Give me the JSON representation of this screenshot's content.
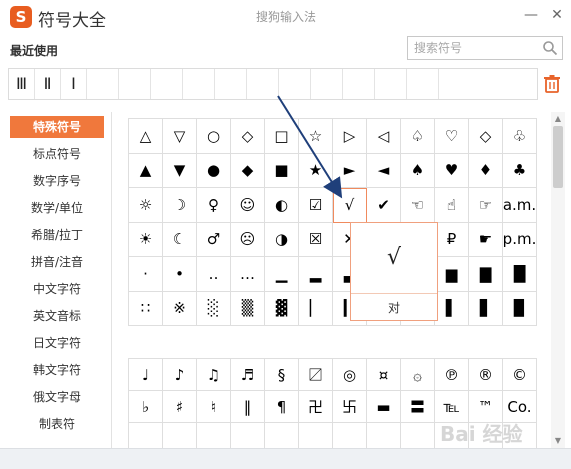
{
  "app": {
    "logo_letter": "S",
    "title": "符号大全",
    "ime_name": "搜狗输入法",
    "minimize": "—",
    "close": "✕"
  },
  "recent": {
    "label": "最近使用",
    "items": [
      "Ⅲ",
      "Ⅱ",
      "Ⅰ",
      "",
      "",
      "",
      "",
      "",
      "",
      "",
      "",
      "",
      "",
      "",
      ""
    ]
  },
  "search": {
    "placeholder": "搜索符号",
    "value": ""
  },
  "categories": [
    {
      "label": "特殊符号",
      "active": true
    },
    {
      "label": "标点符号",
      "active": false
    },
    {
      "label": "数字序号",
      "active": false
    },
    {
      "label": "数学/单位",
      "active": false
    },
    {
      "label": "希腊/拉丁",
      "active": false
    },
    {
      "label": "拼音/注音",
      "active": false
    },
    {
      "label": "中文字符",
      "active": false
    },
    {
      "label": "英文音标",
      "active": false
    },
    {
      "label": "日文字符",
      "active": false
    },
    {
      "label": "韩文字符",
      "active": false
    },
    {
      "label": "俄文字母",
      "active": false
    },
    {
      "label": "制表符",
      "active": false
    }
  ],
  "grid1": [
    [
      "△",
      "▽",
      "○",
      "◇",
      "□",
      "☆",
      "▷",
      "◁",
      "♤",
      "♡",
      "◇",
      "♧"
    ],
    [
      "▲",
      "▼",
      "●",
      "◆",
      "■",
      "★",
      "►",
      "◄",
      "♠",
      "♥",
      "♦",
      "♣"
    ],
    [
      "☼",
      "☽",
      "♀",
      "☺",
      "◐",
      "☑",
      "√",
      "✔",
      "☜",
      "☝",
      "☞",
      "a.m."
    ],
    [
      "☀",
      "☾",
      "♂",
      "☹",
      "◑",
      "☒",
      "✕",
      "",
      "",
      "₽",
      "☛",
      "p.m."
    ],
    [
      "·",
      "•",
      "‥",
      "…",
      "▁",
      "▂",
      "▃",
      "",
      "",
      "▆",
      "▇",
      "█"
    ],
    [
      "∷",
      "※",
      "░",
      "▒",
      "▓",
      "▏",
      "▎",
      "",
      "",
      "▌",
      "▋",
      "▉"
    ]
  ],
  "grid2": [
    [
      "♩",
      "♪",
      "♫",
      "♬",
      "§",
      "〼",
      "◎",
      "¤",
      "۞",
      "℗",
      "®",
      "©"
    ],
    [
      "♭",
      "♯",
      "♮",
      "‖",
      "¶",
      "卍",
      "卐",
      "▬",
      "〓",
      "℡",
      "™",
      "Co."
    ],
    [
      "",
      "",
      "",
      "",
      "",
      "",
      "",
      "",
      "",
      "",
      "",
      ""
    ]
  ],
  "popup": {
    "symbol": "√",
    "name": "对"
  },
  "watermark": "Bai 经验",
  "colors": {
    "accent": "#f0783c",
    "arrow": "#1f3f7a"
  }
}
